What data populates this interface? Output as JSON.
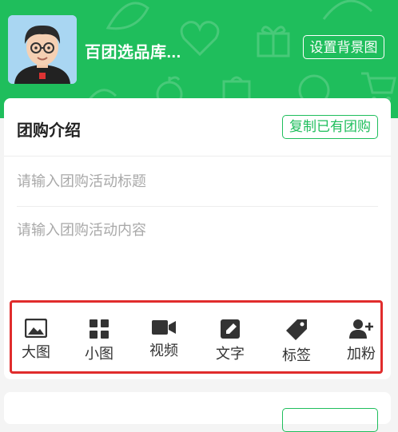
{
  "header": {
    "shop_name": "百团选品库...",
    "set_bg_label": "设置背景图"
  },
  "intro_card": {
    "title": "团购介绍",
    "copy_label": "复制已有团购",
    "title_placeholder": "请输入团购活动标题",
    "content_placeholder": "请输入团购活动内容"
  },
  "toolbar": {
    "items": [
      {
        "label": "大图",
        "icon": "large-image-icon"
      },
      {
        "label": "小图",
        "icon": "small-image-grid-icon"
      },
      {
        "label": "视频",
        "icon": "video-camera-icon"
      },
      {
        "label": "文字",
        "icon": "edit-text-icon"
      },
      {
        "label": "标签",
        "icon": "tag-icon"
      },
      {
        "label": "加粉",
        "icon": "add-follower-icon"
      }
    ]
  },
  "colors": {
    "brand_green": "#1fbe5c",
    "highlight_red": "#e02c2c"
  }
}
